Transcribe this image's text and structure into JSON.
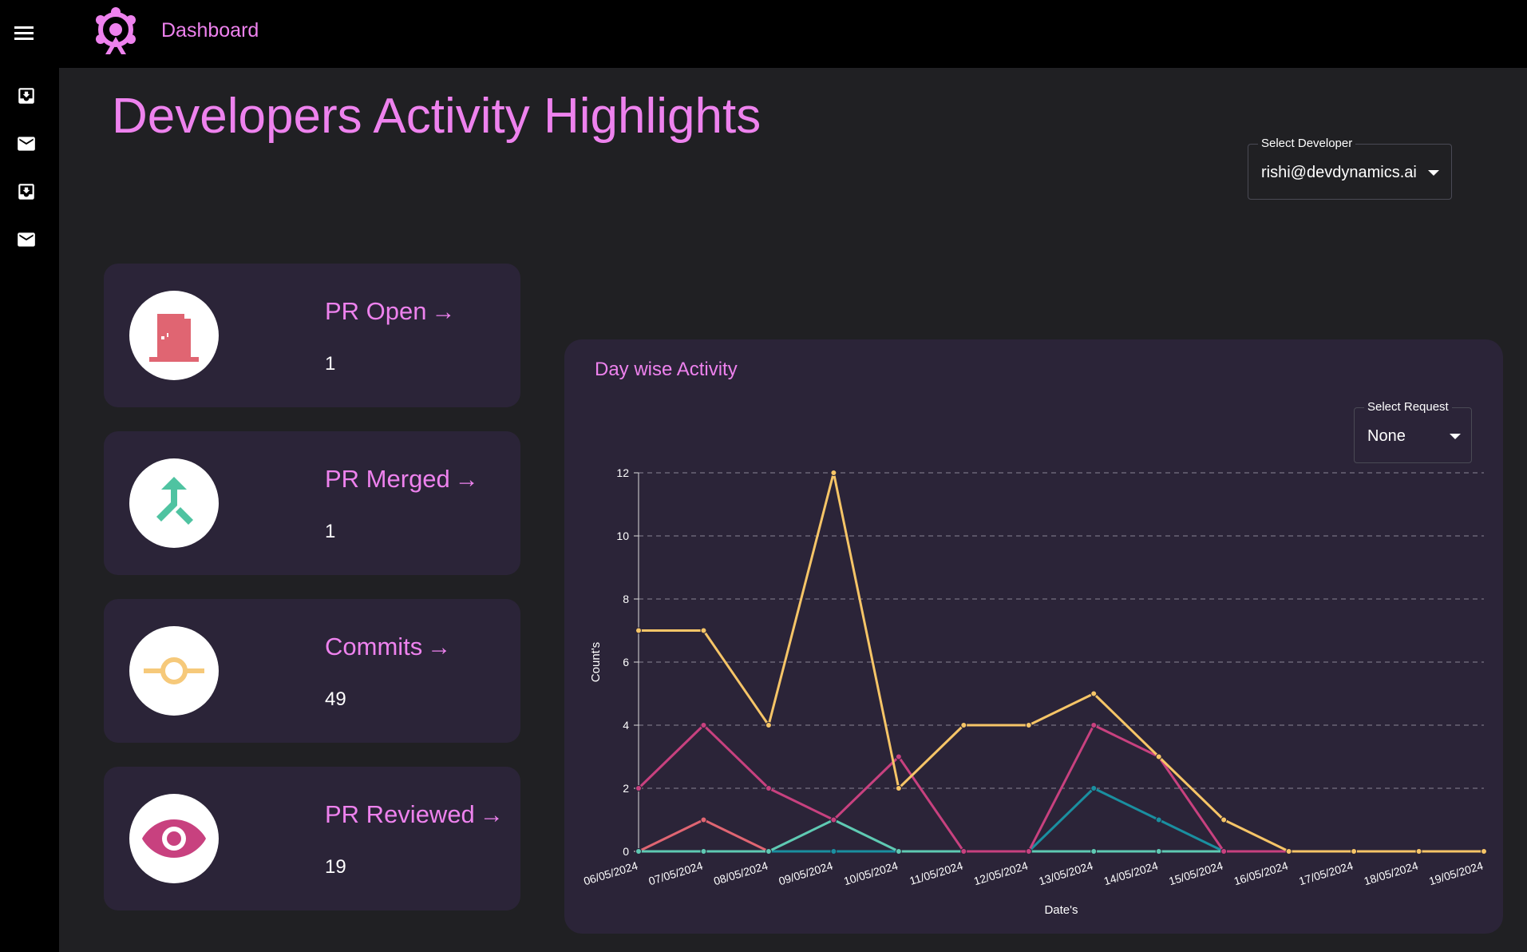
{
  "app": {
    "title": "Dashboard"
  },
  "icons": {
    "menu": "menu-icon",
    "logo": "logo-icon",
    "sidebar": [
      "move-to-inbox-icon",
      "mail-icon",
      "move-to-inbox-icon",
      "mail-icon"
    ]
  },
  "page": {
    "title": "Developers Activity Highlights"
  },
  "developer_select": {
    "label": "Select Developer",
    "value": "rishi@devdynamics.ai"
  },
  "cards": [
    {
      "title": "PR Open",
      "value": "1",
      "icon": "door-icon",
      "color": "#e06572"
    },
    {
      "title": "PR Merged",
      "value": "1",
      "icon": "merge-icon",
      "color": "#4fc3a1"
    },
    {
      "title": "Commits",
      "value": "49",
      "icon": "commit-icon",
      "color": "#f6c97a"
    },
    {
      "title": "PR Reviewed",
      "value": "19",
      "icon": "eye-icon",
      "color": "#c8417f"
    }
  ],
  "chart_panel": {
    "title": "Day wise Activity",
    "request_select": {
      "label": "Select Request",
      "value": "None"
    }
  },
  "chart_data": {
    "type": "line",
    "xlabel": "Date's",
    "ylabel": "Count's",
    "ylim": [
      0,
      12
    ],
    "yticks": [
      0,
      2,
      4,
      6,
      8,
      10,
      12
    ],
    "grid": true,
    "categories": [
      "06/05/2024",
      "07/05/2024",
      "08/05/2024",
      "09/05/2024",
      "10/05/2024",
      "11/05/2024",
      "12/05/2024",
      "13/05/2024",
      "14/05/2024",
      "15/05/2024",
      "16/05/2024",
      "17/05/2024",
      "18/05/2024",
      "19/05/2024"
    ],
    "series": [
      {
        "color": "#f6c567",
        "values": [
          7,
          7,
          4,
          12,
          2,
          4,
          4,
          5,
          3,
          1,
          0,
          0,
          0,
          0
        ]
      },
      {
        "color": "#c8417f",
        "values": [
          2,
          4,
          2,
          1,
          3,
          0,
          0,
          4,
          3,
          0,
          0,
          0,
          0,
          0
        ]
      },
      {
        "color": "#5fcab3",
        "values": [
          0,
          0,
          0,
          1,
          0,
          0,
          0,
          0,
          0,
          0,
          0,
          0,
          0,
          0
        ]
      },
      {
        "color": "#1a8fa0",
        "values": [
          0,
          0,
          0,
          0,
          0,
          0,
          0,
          2,
          1,
          0,
          0,
          0,
          0,
          0
        ]
      },
      {
        "color": "#e06572",
        "values": [
          0,
          1,
          0,
          0,
          0,
          0,
          0,
          0,
          0,
          0,
          0,
          0,
          0,
          0
        ]
      }
    ]
  }
}
